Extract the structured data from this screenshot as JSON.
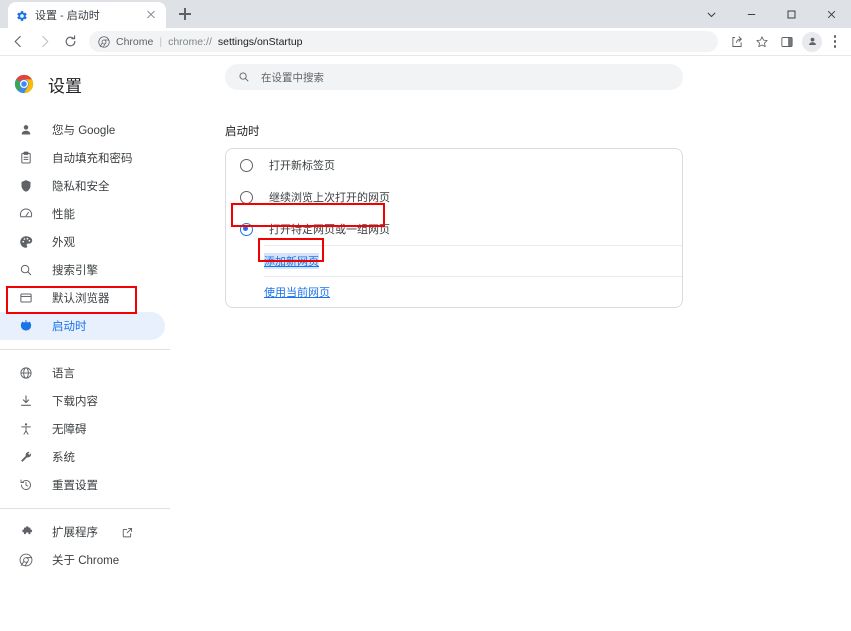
{
  "window": {
    "controls": [
      {
        "name": "tab-search-chevron",
        "glyph": "chevron-down-icon"
      },
      {
        "name": "minimize",
        "glyph": "minimize-icon"
      },
      {
        "name": "maximize",
        "glyph": "maximize-icon"
      },
      {
        "name": "close",
        "glyph": "close-icon"
      }
    ]
  },
  "tabstrip": {
    "tab_title": "设置 - 启动时",
    "favicon": "settings-gear-icon",
    "close_label": "关闭",
    "newtab_label": "新建标签页"
  },
  "toolbar": {
    "back_label": "返回",
    "forward_label": "前进",
    "reload_label": "重新加载",
    "omnibox": {
      "site_chip": "Chrome",
      "separator": "|",
      "url_scheme": "chrome://",
      "url_path": "settings/onStartup"
    },
    "share_label": "分享此标签页",
    "bookmark_label": "为此标签页添加书签",
    "sidepanel_label": "显示side panel",
    "profile_label": "个人资料",
    "menu_label": "自定义及控制 Google Chrome"
  },
  "settings": {
    "brand": "设置",
    "brand_icon": "chrome-logo-icon",
    "search": {
      "placeholder": "在设置中搜索",
      "icon": "search-icon"
    },
    "sidebar": {
      "items": [
        {
          "label": "您与 Google",
          "icon": "person-icon",
          "selected": false
        },
        {
          "label": "自动填充和密码",
          "icon": "clipboard-icon",
          "selected": false
        },
        {
          "label": "隐私和安全",
          "icon": "shield-icon",
          "selected": false
        },
        {
          "label": "性能",
          "icon": "speedometer-icon",
          "selected": false
        },
        {
          "label": "外观",
          "icon": "palette-icon",
          "selected": false
        },
        {
          "label": "搜索引擎",
          "icon": "search-icon",
          "selected": false
        },
        {
          "label": "默认浏览器",
          "icon": "browser-icon",
          "selected": false
        },
        {
          "label": "启动时",
          "icon": "power-icon",
          "selected": true
        }
      ],
      "items_group2": [
        {
          "label": "语言",
          "icon": "globe-icon"
        },
        {
          "label": "下载内容",
          "icon": "download-icon"
        },
        {
          "label": "无障碍",
          "icon": "accessibility-icon"
        },
        {
          "label": "系统",
          "icon": "wrench-icon"
        },
        {
          "label": "重置设置",
          "icon": "history-restore-icon"
        }
      ],
      "items_group3": [
        {
          "label": "扩展程序",
          "icon": "puzzle-icon",
          "external": true
        },
        {
          "label": "关于 Chrome",
          "icon": "chrome-logo-icon",
          "external": false
        }
      ]
    },
    "startup": {
      "section_title": "启动时",
      "options": [
        {
          "label": "打开新标签页",
          "checked": false
        },
        {
          "label": "继续浏览上次打开的网页",
          "checked": false
        },
        {
          "label": "打开特定网页或一组网页",
          "checked": true
        }
      ],
      "add_page_link": "添加新网页",
      "use_current_link": "使用当前网页"
    }
  },
  "annotations": {
    "accent_red": "#f00202",
    "accent_blue": "#1a73e8",
    "selected_pill_bg": "#e8f0fe",
    "highlight_bg": "#d7e3fb"
  }
}
